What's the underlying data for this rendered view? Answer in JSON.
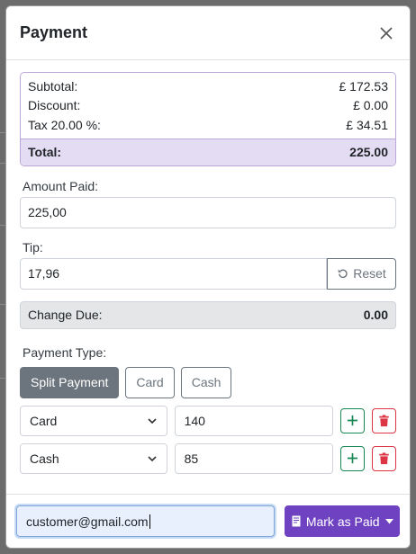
{
  "modal": {
    "title": "Payment"
  },
  "summary": {
    "subtotal_label": "Subtotal:",
    "subtotal_value": "£ 172.53",
    "discount_label": "Discount:",
    "discount_value": "£ 0.00",
    "tax_label": "Tax 20.00 %:",
    "tax_value": "£ 34.51",
    "total_label": "Total:",
    "total_value": "225.00"
  },
  "amount_paid": {
    "label": "Amount Paid:",
    "value": "225,00"
  },
  "tip": {
    "label": "Tip:",
    "value": "17,96",
    "reset_label": "Reset"
  },
  "change_due": {
    "label": "Change Due:",
    "value": "0.00"
  },
  "payment_type": {
    "label": "Payment Type:",
    "options": [
      "Split Payment",
      "Card",
      "Cash"
    ],
    "selected": "Split Payment"
  },
  "split_rows": [
    {
      "method": "Card",
      "amount": "140"
    },
    {
      "method": "Cash",
      "amount": "85"
    }
  ],
  "footer": {
    "email": "customer@gmail.com",
    "mark_paid_label": "Mark as Paid"
  },
  "colors": {
    "accent": "#6f42c1",
    "summary_total_bg": "#e3dcf2",
    "secondary": "#6c757d",
    "success": "#198754",
    "danger": "#dc3545"
  }
}
